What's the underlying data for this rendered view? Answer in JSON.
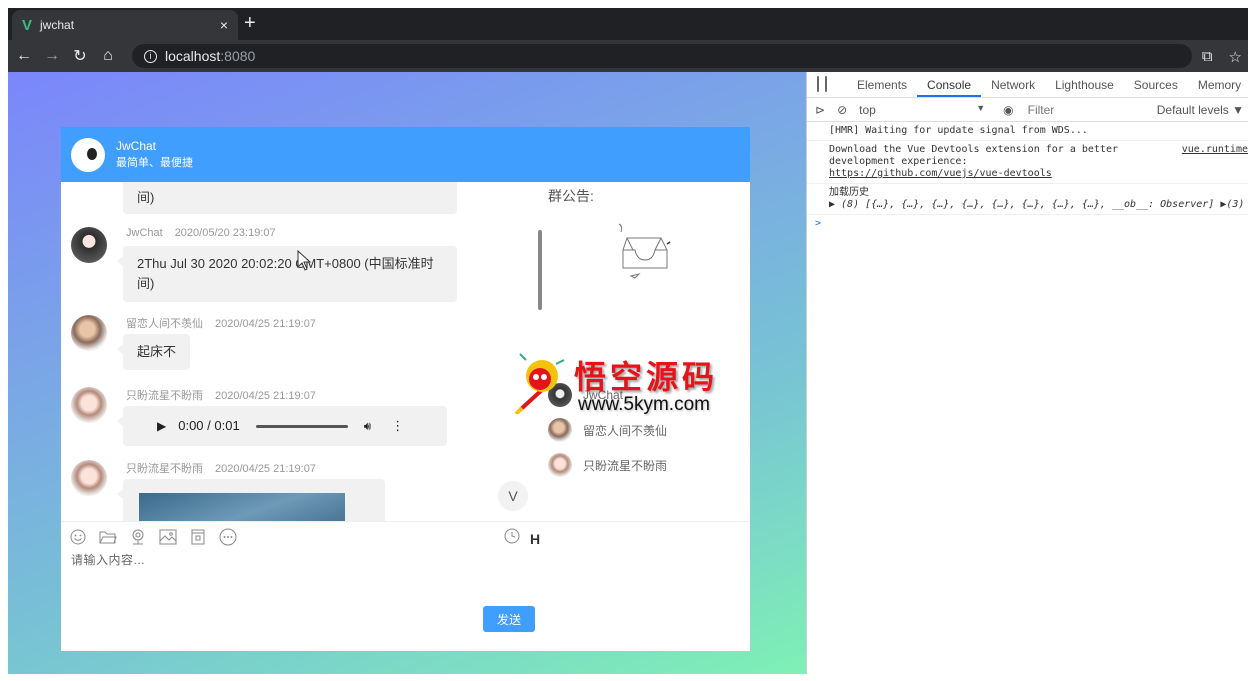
{
  "browser": {
    "tab_title": "jwchat",
    "tab_close": "×",
    "new_tab": "+",
    "url_host": "localhost",
    "url_port": ":8080"
  },
  "chat": {
    "header": {
      "title": "JwChat",
      "subtitle": "最简单、最便捷"
    },
    "messages": [
      {
        "type": "text",
        "name": "",
        "time": "",
        "text": "间)"
      },
      {
        "type": "text",
        "name": "JwChat",
        "time": "2020/05/20 23:19:07",
        "text": "2Thu Jul 30 2020 20:02:20 GMT+0800 (中国标准时间)"
      },
      {
        "type": "text",
        "name": "留恋人间不羡仙",
        "time": "2020/04/25 21:19:07",
        "text": "起床不"
      },
      {
        "type": "audio",
        "name": "只盼流星不盼雨",
        "time": "2020/04/25 21:19:07",
        "audio_time": "0:00 / 0:01"
      },
      {
        "type": "image",
        "name": "只盼流星不盼雨",
        "time": "2020/04/25 21:19:07"
      }
    ],
    "sidebar": {
      "notice_title": "群公告:",
      "members": [
        {
          "name": "JwChat"
        },
        {
          "name": "留恋人间不羡仙"
        },
        {
          "name": "只盼流星不盼雨"
        }
      ],
      "v_button": "V"
    },
    "toolbar": {
      "icons": [
        "emoji-icon",
        "folder-icon",
        "video-icon",
        "image-icon",
        "file-icon",
        "more-icon"
      ],
      "history_label": "H"
    },
    "input_placeholder": "请输入内容...",
    "send_label": "发送"
  },
  "watermark": {
    "cn": "悟空源码",
    "url": "www.5kym.com"
  },
  "devtools": {
    "tabs": [
      "Elements",
      "Console",
      "Network",
      "Lighthouse",
      "Sources",
      "Memory"
    ],
    "active_tab": "Console",
    "context": "top",
    "filter_placeholder": "Filter",
    "levels": "Default levels ▼",
    "logs": {
      "hmr": "[HMR] Waiting for update signal from WDS...",
      "vue_line1": "Download the Vue Devtools extension for a better",
      "vue_line2": "development experience:",
      "vue_link": "https://github.com/vuejs/vue-devtools",
      "vue_src": "vue.runtime",
      "history_label": "加载历史",
      "history_array": "▶ (8) [{…}, {…}, {…}, {…}, {…}, {…}, {…}, {…}, __ob__: Observer] ▶(3)"
    },
    "prompt": ">"
  }
}
